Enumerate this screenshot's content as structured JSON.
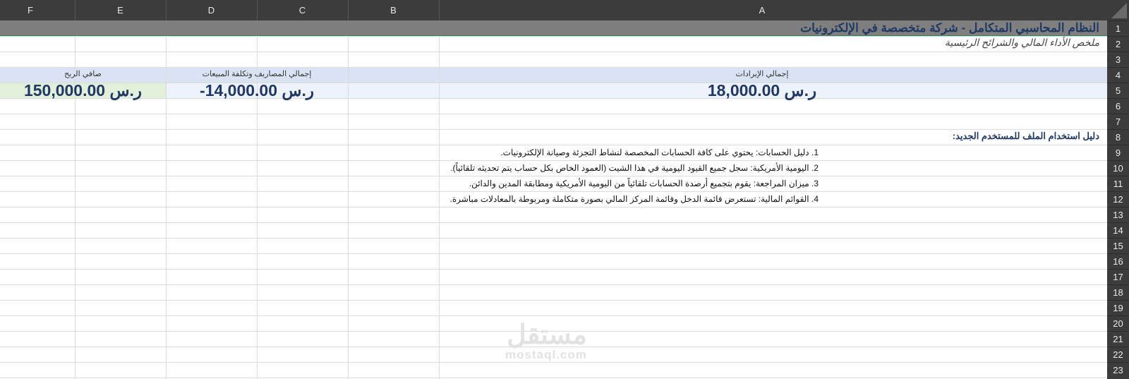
{
  "columns": [
    "F",
    "E",
    "D",
    "C",
    "B",
    "A"
  ],
  "rows": [
    "1",
    "2",
    "3",
    "4",
    "5",
    "6",
    "7",
    "8",
    "9",
    "10",
    "11",
    "12",
    "13",
    "14",
    "15",
    "16",
    "17",
    "18",
    "19",
    "20",
    "21",
    "22",
    "23"
  ],
  "sheet": {
    "title": "النظام المحاسبي المتكامل - شركة متخصصة في الإلكترونيات",
    "subtitle": "ملخص الأداء المالي والشرائح الرئيسية",
    "metrics": {
      "revenue": {
        "label": "إجمالي الإيرادات",
        "value": "ر.س 18,000.00"
      },
      "expenses": {
        "label": "إجمالي المصاريف وتكلفة المبيعات",
        "value": "ر.س 14,000.00-"
      },
      "net_profit": {
        "label": "صافي الربح",
        "value": "ر.س 150,000.00"
      }
    },
    "guide": {
      "title": "دليل استخدام الملف للمستخدم الجديد:",
      "items": [
        "1. دليل الحسابات: يحتوي على كافة الحسابات المخصصة لنشاط التجزئة وصيانة الإلكترونيات.",
        "2. اليومية الأمريكية: سجل جميع القيود اليومية في هذا الشيت (العمود الخاص بكل حساب يتم تحديثه تلقائياً).",
        "3. ميزان المراجعة: يقوم بتجميع أرصدة الحسابات تلقائياً من اليومية الأمريكية ومطابقة المدين والدائن.",
        "4. القوائم المالية: تستعرض قائمة الدخل وقائمة المركز المالي بصورة متكاملة ومربوطة بالمعادلات مباشرة."
      ]
    }
  },
  "watermark": {
    "main": "مستقل",
    "sub": "mostaql.com"
  },
  "colors": {
    "header_bg": "#3c3c3c",
    "title_band": "#7f7f7f",
    "metric_band": "#dae3f3",
    "metric_value_band": "#eef2fa",
    "profit_band": "#e2efda",
    "accent_text": "#1f3864"
  }
}
